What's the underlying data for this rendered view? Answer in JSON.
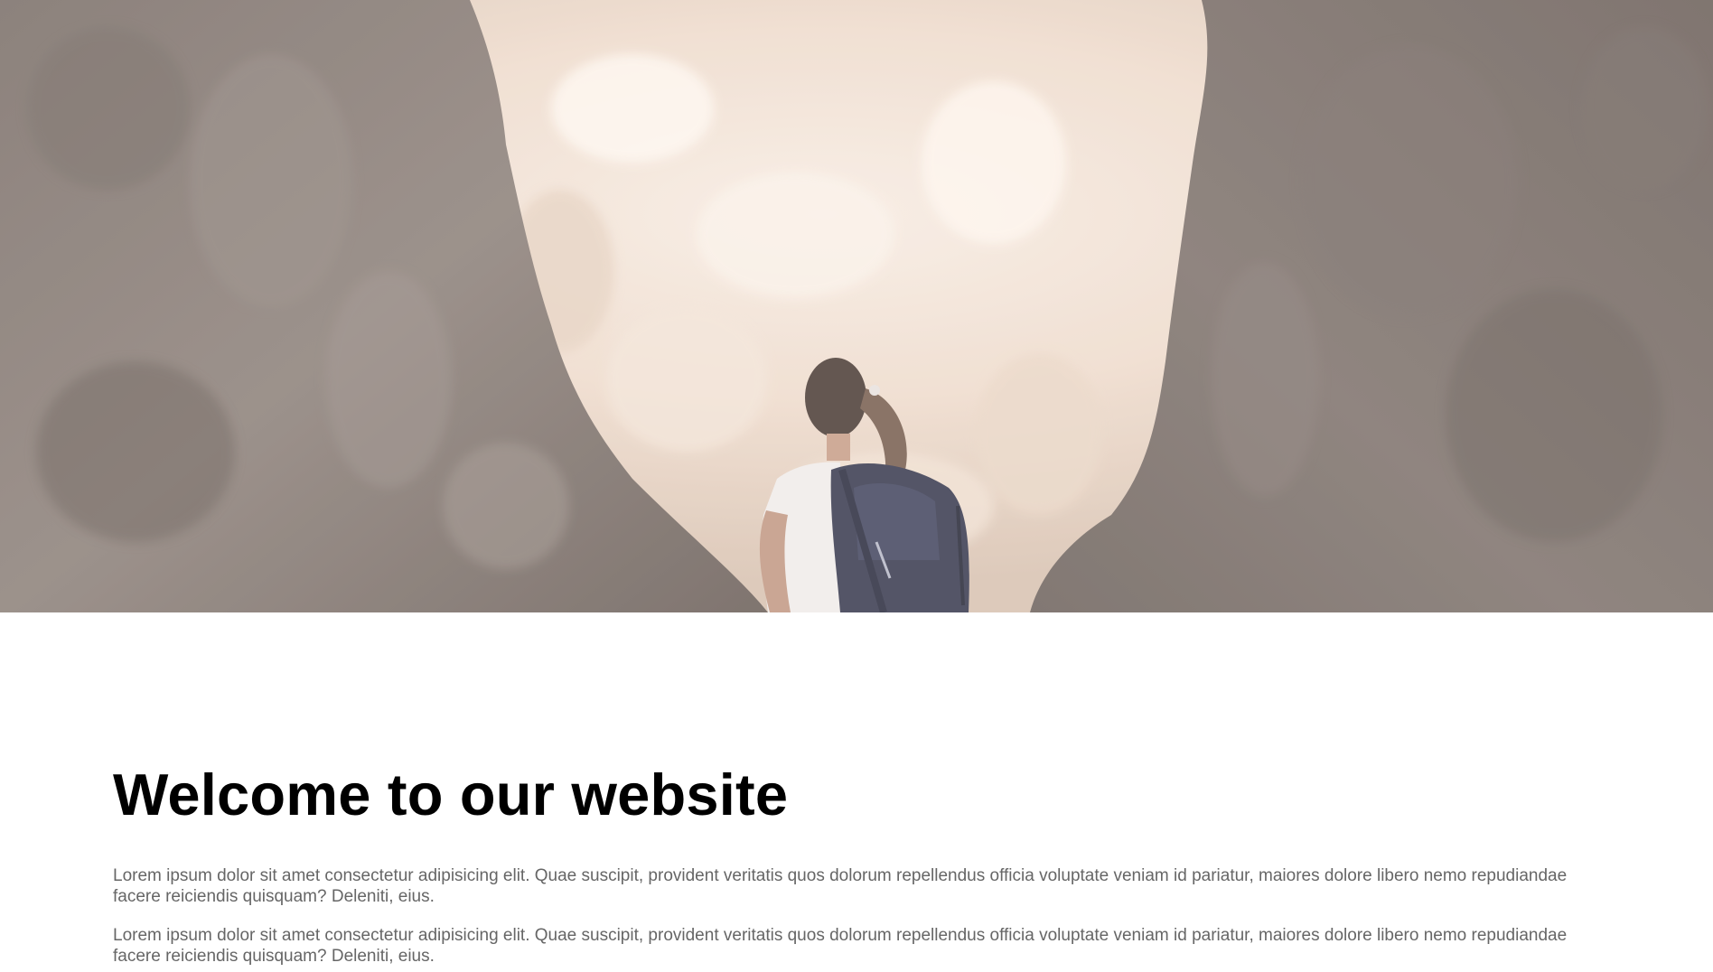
{
  "hero": {
    "image": "hiker-in-canyon-photo"
  },
  "main": {
    "title": "Welcome to our website",
    "paragraphs": [
      "Lorem ipsum dolor sit amet consectetur adipisicing elit. Quae suscipit, provident veritatis quos dolorum repellendus officia voluptate veniam id pariatur, maiores dolore libero nemo repudiandae facere reiciendis quisquam? Deleniti, eius.",
      "Lorem ipsum dolor sit amet consectetur adipisicing elit. Quae suscipit, provident veritatis quos dolorum repellendus officia voluptate veniam id pariatur, maiores dolore libero nemo repudiandae facere reiciendis quisquam? Deleniti, eius."
    ]
  },
  "colors": {
    "heading": "#000000",
    "body_text": "#666666",
    "background": "#ffffff"
  }
}
